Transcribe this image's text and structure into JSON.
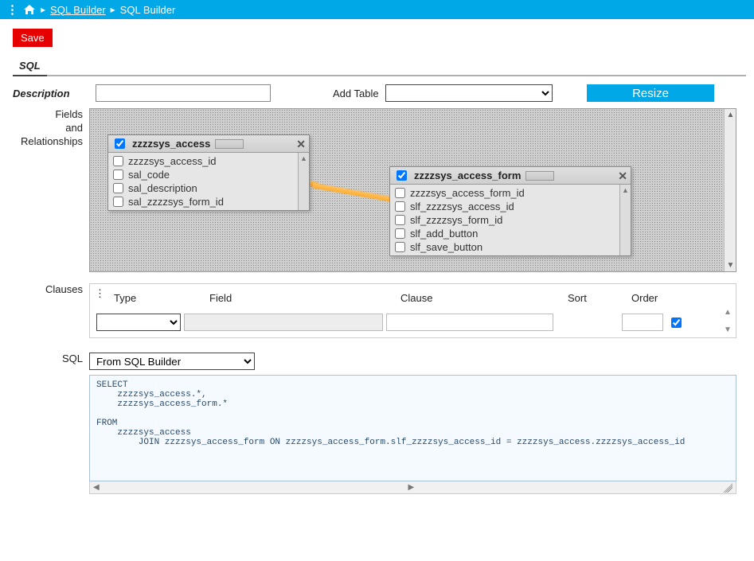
{
  "breadcrumb": {
    "link": "SQL Builder",
    "current": "SQL Builder"
  },
  "buttons": {
    "save": "Save",
    "resize": "Resize"
  },
  "tabs": {
    "sql": "SQL"
  },
  "labels": {
    "description": "Description",
    "add_table": "Add Table",
    "fields_rels": "Fields\nand\nRelationships",
    "clauses": "Clauses",
    "sql": "SQL"
  },
  "inputs": {
    "description_value": ""
  },
  "tables": {
    "t1": {
      "name": "zzzzsys_access",
      "checked": true,
      "columns": [
        "zzzzsys_access_id",
        "sal_code",
        "sal_description",
        "sal_zzzzsys_form_id"
      ]
    },
    "t2": {
      "name": "zzzzsys_access_form",
      "checked": true,
      "columns": [
        "zzzzsys_access_form_id",
        "slf_zzzzsys_access_id",
        "slf_zzzzsys_form_id",
        "slf_add_button",
        "slf_save_button"
      ]
    }
  },
  "clauses": {
    "headers": {
      "type": "Type",
      "field": "Field",
      "clause": "Clause",
      "sort": "Sort",
      "order": "Order"
    },
    "row": {
      "type": "",
      "field": "",
      "clause": "",
      "order": "",
      "checked": true
    }
  },
  "sql_source": {
    "selected": "From SQL Builder"
  },
  "sql_text": "SELECT\n    zzzzsys_access.*,\n    zzzzsys_access_form.*\n\nFROM\n    zzzzsys_access\n        JOIN zzzzsys_access_form ON zzzzsys_access_form.slf_zzzzsys_access_id = zzzzsys_access.zzzzsys_access_id"
}
